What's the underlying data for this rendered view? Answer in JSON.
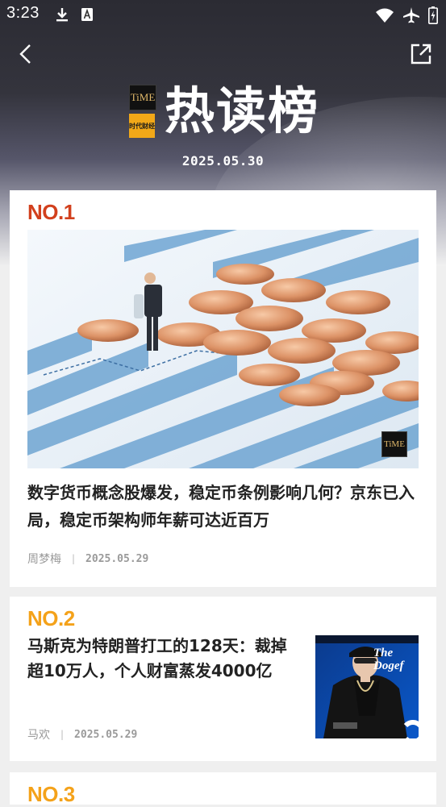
{
  "status_bar": {
    "time": "3:23",
    "icons_left": [
      "download-icon",
      "keyboard-a-icon"
    ],
    "icons_right": [
      "wifi-icon",
      "airplane-icon",
      "battery-icon"
    ]
  },
  "nav": {
    "back_icon": "chevron-left-icon",
    "share_icon": "share-external-icon"
  },
  "header": {
    "logo_time_text": "TiME",
    "logo_caijing_text": "时代财经",
    "title": "热读榜",
    "date": "2025.05.30"
  },
  "articles": [
    {
      "rank": "NO.1",
      "title": "数字货币概念股爆发，稳定币条例影响几何？京东已入局，稳定币架构师年薪可达近百万",
      "author": "周梦梅",
      "separator": "|",
      "date": "2025.05.29",
      "image": "coins-and-businessman-figure",
      "watermark": "TiME"
    },
    {
      "rank": "NO.2",
      "title": "马斯克为特朗普打工的128天：裁掉超10万人，个人财富蒸发4000亿",
      "author": "马欢",
      "separator": "|",
      "date": "2025.05.29",
      "image": "man-with-cap-and-sunglasses",
      "image_caption": "The Dogef"
    },
    {
      "rank": "NO.3"
    }
  ],
  "colors": {
    "rank1": "#d2401d",
    "rank_other": "#f4a21a",
    "logo_orange": "#f2a818"
  }
}
